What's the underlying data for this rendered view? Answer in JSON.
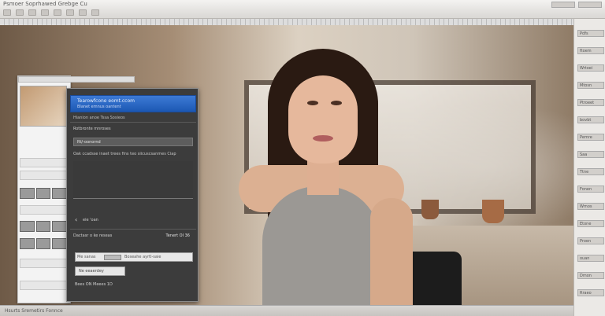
{
  "app": {
    "title": "Psmoer Soprhawed Grebge Cu"
  },
  "dialog": {
    "url_line1": "Tearowfcone eomt.ccom",
    "url_line2": "Blanet emnus oantent",
    "tabs": "Hianion anoe  Tssa Sosieos",
    "section_label": "Rotbronte mnroses",
    "field_value": "Rt/-oonornd",
    "description": "Oak ccadsse inaet trees fins teo siicuscsanmes Ciap",
    "nav_label": "eie 'oan",
    "status_left": "Dactasr o ke reseas",
    "status_right": "Tenert OI  36",
    "input_left": "Me  sanas",
    "input_right": "Boseahe ayrtl-saie",
    "small_label": "Ne eeaerdey",
    "footer": "Bees  ON  Meees 1D"
  },
  "right_panel": {
    "items": [
      "Pdfs",
      "ftoem",
      "Wrtoei",
      "Mtosn",
      "Ptroeet",
      "bovbt",
      "Pemre",
      "Saa",
      "Ttne",
      "Fonen",
      "Wrnos",
      "Etone",
      "Proen",
      "ouan",
      "Dmon",
      "Rraeo"
    ]
  },
  "status_bar": {
    "text": "Hsurts  Sremetirs  Fonnce"
  }
}
